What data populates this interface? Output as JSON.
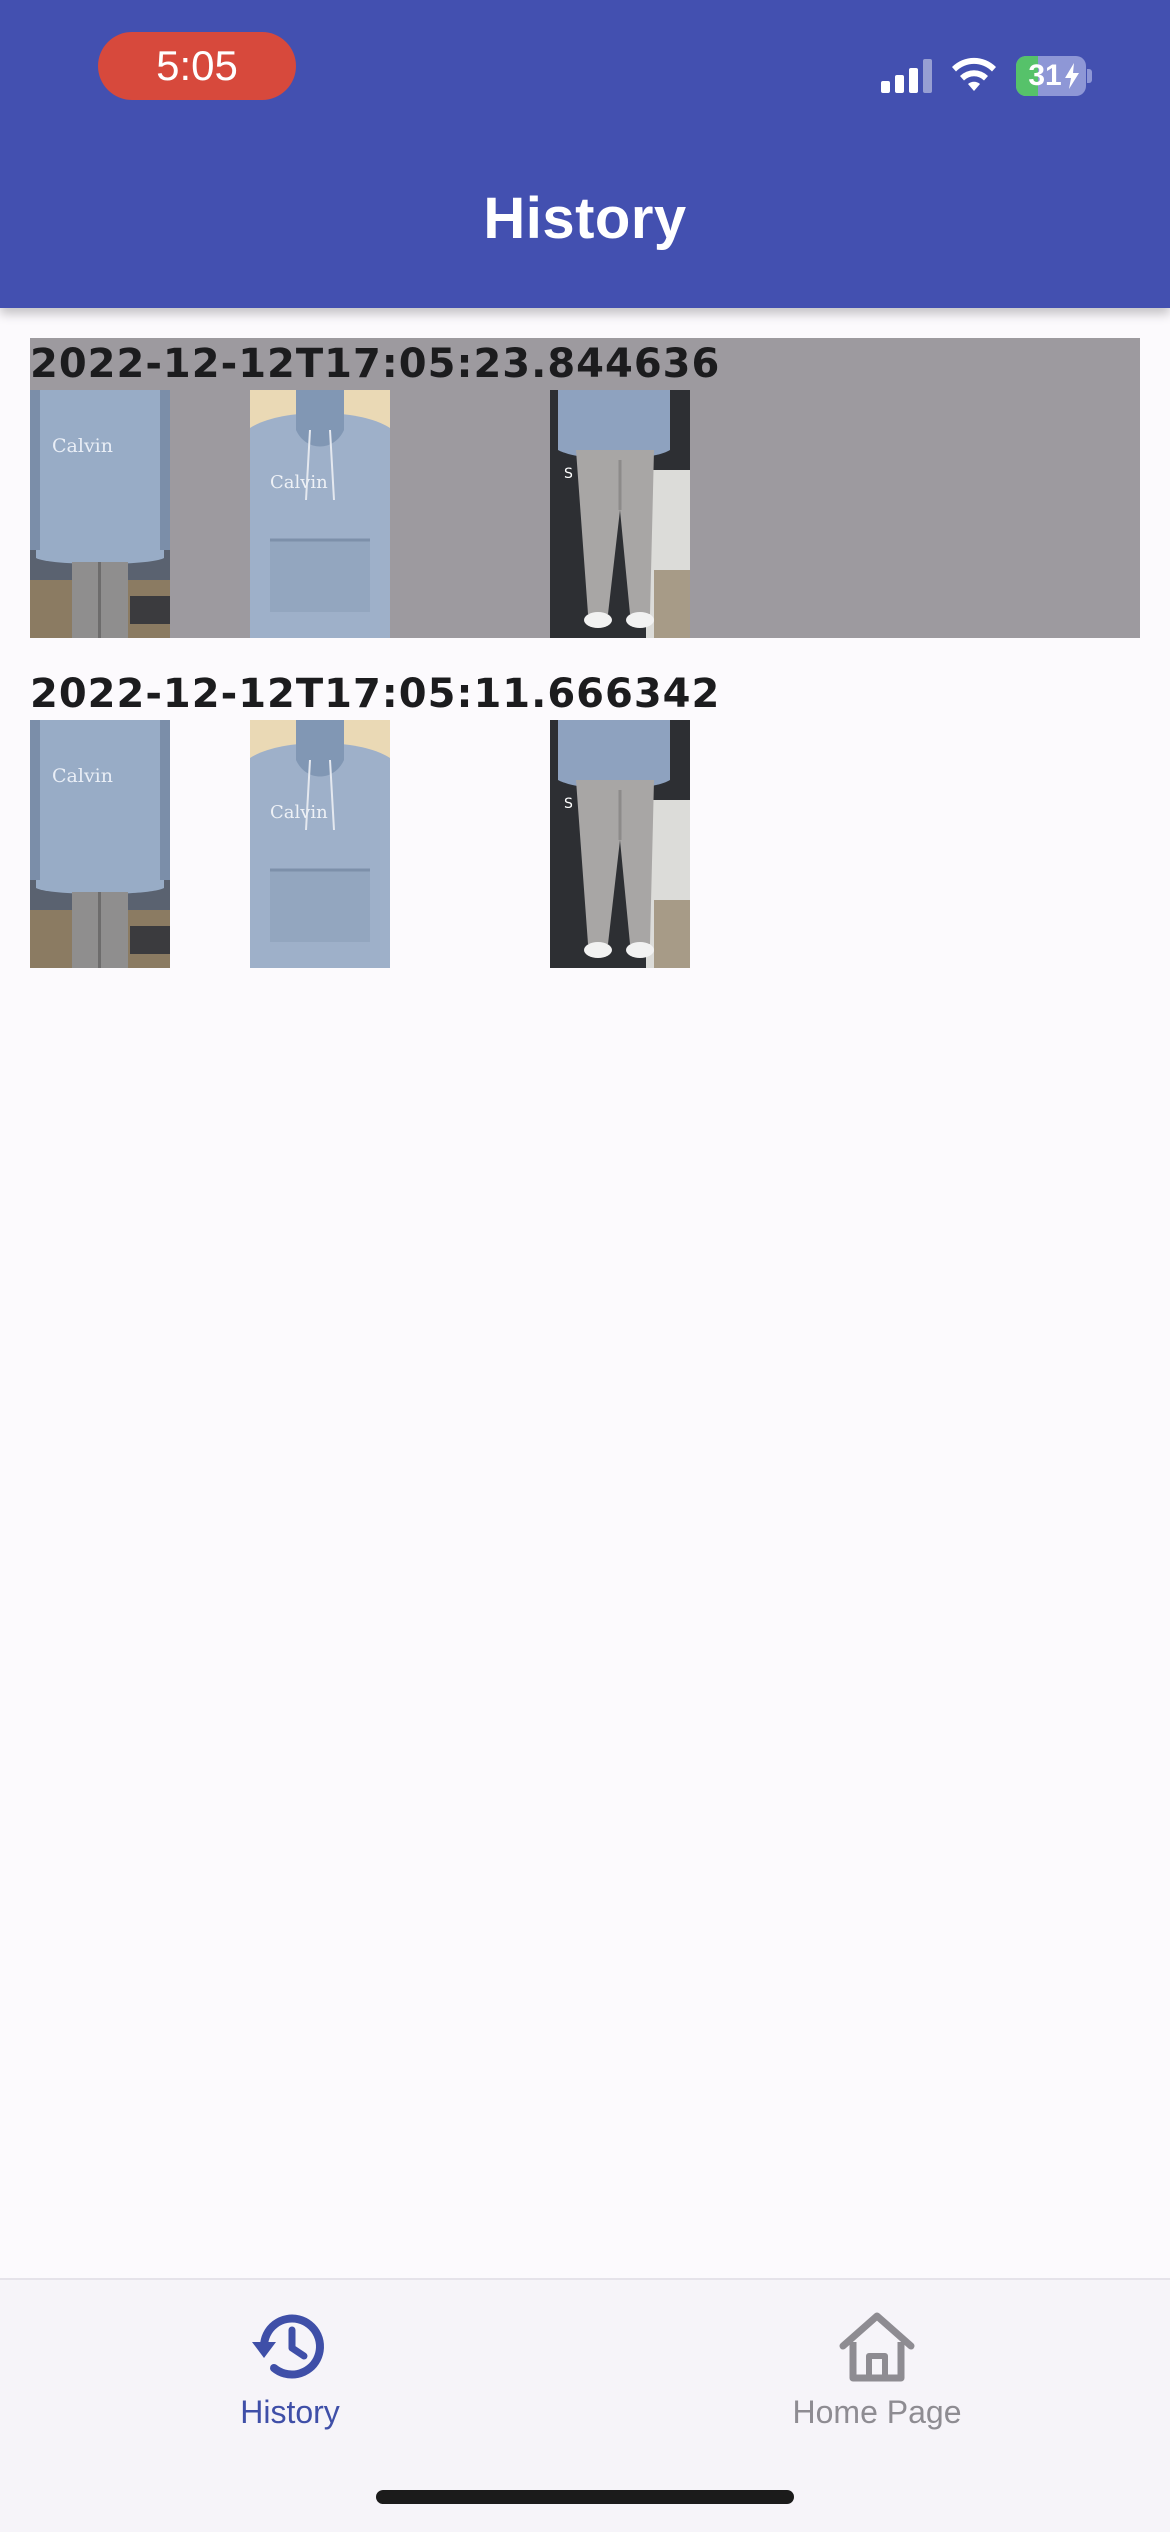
{
  "status_bar": {
    "time": "5:05",
    "battery": "31",
    "battery_level": 0.31,
    "icons": [
      "cellular-signal-icon",
      "wifi-icon",
      "battery-charging-icon"
    ]
  },
  "app_bar": {
    "title": "History",
    "background": "#4350b0"
  },
  "history": {
    "items": [
      {
        "timestamp": "2022-12-12T17:05:23.844636",
        "selected": true,
        "thumbnails": [
          "hoodie-front-photo",
          "hoodie-closeup-photo",
          "pants-photo"
        ]
      },
      {
        "timestamp": "2022-12-12T17:05:11.666342",
        "selected": false,
        "thumbnails": [
          "hoodie-front-photo",
          "hoodie-closeup-photo",
          "pants-photo"
        ]
      }
    ]
  },
  "bottom_nav": {
    "items": [
      {
        "label": "History",
        "icon": "history-icon",
        "active": true
      },
      {
        "label": "Home Page",
        "icon": "home-icon",
        "active": false
      }
    ],
    "active_color": "#3f4fa8",
    "inactive_color": "#8e8c92"
  }
}
